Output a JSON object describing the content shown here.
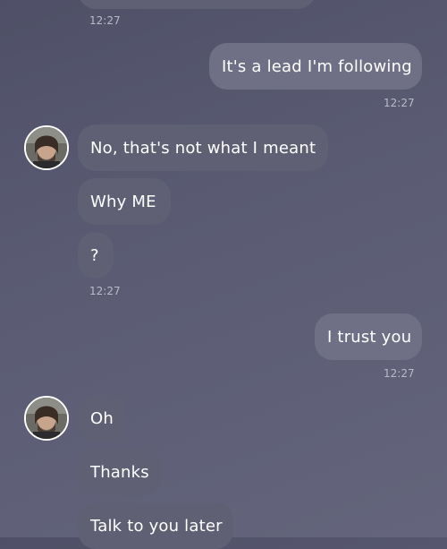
{
  "messages": {
    "top_time": "12:27",
    "m1": {
      "text": "It's a lead I'm following",
      "time": "12:27"
    },
    "m2": {
      "text": "No, that's not what I meant"
    },
    "m3": {
      "text": "Why ME"
    },
    "m4": {
      "text": "?",
      "time": "12:27"
    },
    "m5": {
      "text": "I trust you",
      "time": "12:27"
    },
    "m6": {
      "text": "Oh"
    },
    "m7": {
      "text": "Thanks"
    },
    "m8": {
      "text": "Talk to you later"
    }
  }
}
